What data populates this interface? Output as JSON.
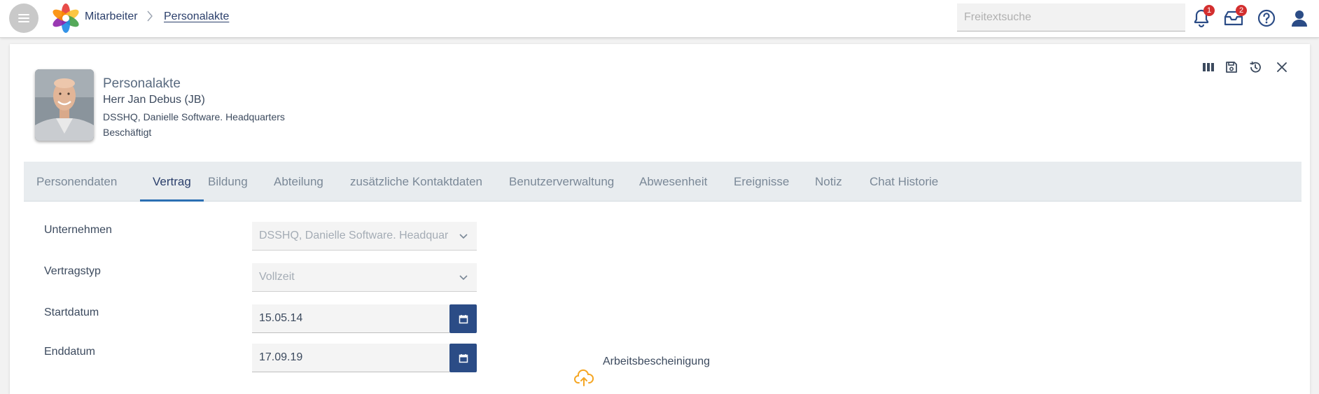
{
  "header": {
    "breadcrumb_root": "Mitarbeiter",
    "breadcrumb_separator": ">",
    "breadcrumb_current": "Personalakte",
    "search_placeholder": "Freitextsuche",
    "notifications_count": "1",
    "messages_count": "2",
    "badge_color": "#d32f2f",
    "icon_color": "#2b4c86"
  },
  "profile": {
    "section_title": "Personalakte",
    "name": "Herr Jan Debus (JB)",
    "company": "DSSHQ, Danielle Software. Headquarters",
    "status": "Beschäftigt"
  },
  "tabs": [
    {
      "label": "Personendaten"
    },
    {
      "label": "Vertrag"
    },
    {
      "label": "Bildung"
    },
    {
      "label": "Abteilung"
    },
    {
      "label": "zusätzliche Kontaktdaten"
    },
    {
      "label": "Benutzerverwaltung"
    },
    {
      "label": "Abwesenheit"
    },
    {
      "label": "Ereignisse"
    },
    {
      "label": "Notiz"
    },
    {
      "label": "Chat Historie"
    }
  ],
  "active_tab": "Vertrag",
  "form": {
    "company_label": "Unternehmen",
    "company_value": "DSSHQ, Danielle Software. Headquarters",
    "contract_type_label": "Vertragstyp",
    "contract_type_value": "Vollzeit",
    "start_label": "Startdatum",
    "start_value": "15.05.14",
    "end_label": "Enddatum",
    "end_value": "17.09.19",
    "upload_label": "Arbeitsbescheinigung"
  },
  "colors": {
    "primary": "#2b4c86",
    "accent_underline": "#2b6fb3",
    "upload_icon": "#f5a623"
  }
}
